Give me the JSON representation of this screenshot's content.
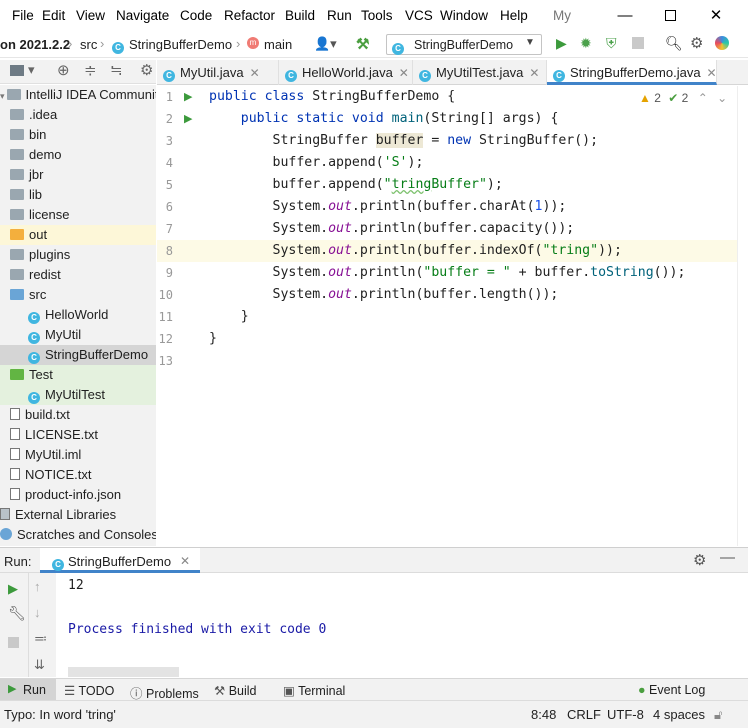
{
  "menu": {
    "items": [
      "File",
      "Edit",
      "View",
      "Navigate",
      "Code",
      "Refactor",
      "Build",
      "Run",
      "Tools",
      "VCS",
      "Window",
      "Help"
    ],
    "project_short": "My"
  },
  "nav": {
    "crumb_project": "on 2021.2.2",
    "crumb_src": "src",
    "crumb_class": "StringBufferDemo",
    "crumb_method": "main",
    "run_config": "StringBufferDemo"
  },
  "project": {
    "root": "IntelliJ IDEA Community E",
    "items": [
      {
        "label": ".idea",
        "kind": "folder"
      },
      {
        "label": "bin",
        "kind": "folder"
      },
      {
        "label": "demo",
        "kind": "folder"
      },
      {
        "label": "jbr",
        "kind": "folder"
      },
      {
        "label": "lib",
        "kind": "folder"
      },
      {
        "label": "license",
        "kind": "folder"
      },
      {
        "label": "out",
        "kind": "folder-orange"
      },
      {
        "label": "plugins",
        "kind": "folder"
      },
      {
        "label": "redist",
        "kind": "folder"
      },
      {
        "label": "src",
        "kind": "folder-blue"
      },
      {
        "label": "HelloWorld",
        "kind": "class"
      },
      {
        "label": "MyUtil",
        "kind": "class"
      },
      {
        "label": "StringBufferDemo",
        "kind": "class"
      },
      {
        "label": "Test",
        "kind": "folder-green"
      },
      {
        "label": "MyUtilTest",
        "kind": "class"
      },
      {
        "label": "build.txt",
        "kind": "file"
      },
      {
        "label": "LICENSE.txt",
        "kind": "file"
      },
      {
        "label": "MyUtil.iml",
        "kind": "file"
      },
      {
        "label": "NOTICE.txt",
        "kind": "file"
      },
      {
        "label": "product-info.json",
        "kind": "file"
      },
      {
        "label": "External Libraries",
        "kind": "lib"
      },
      {
        "label": "Scratches and Consoles",
        "kind": "scratch"
      }
    ]
  },
  "tabs": [
    "MyUtil.java",
    "HelloWorld.java",
    "MyUtilTest.java",
    "StringBufferDemo.java"
  ],
  "inspections": {
    "warnings": "2",
    "weak": "2"
  },
  "code": {
    "lines": [
      "1",
      "2",
      "3",
      "4",
      "5",
      "6",
      "7",
      "8",
      "9",
      "10",
      "11",
      "12",
      "13"
    ]
  },
  "run": {
    "label": "Run:",
    "tab": "StringBufferDemo",
    "output_line": "12",
    "finished": "Process finished with exit code 0"
  },
  "bottom_tools": [
    "Run",
    "TODO",
    "Problems",
    "Build",
    "Terminal"
  ],
  "event_log": "Event Log",
  "status": {
    "message": "Typo: In word 'tring'",
    "position": "8:48",
    "line_sep": "CRLF",
    "encoding": "UTF-8",
    "indent": "4 spaces"
  },
  "colors": {
    "accent": "#4083c9",
    "keyword": "#0033b3",
    "string": "#067d17",
    "number": "#1750eb",
    "static": "#871094"
  }
}
